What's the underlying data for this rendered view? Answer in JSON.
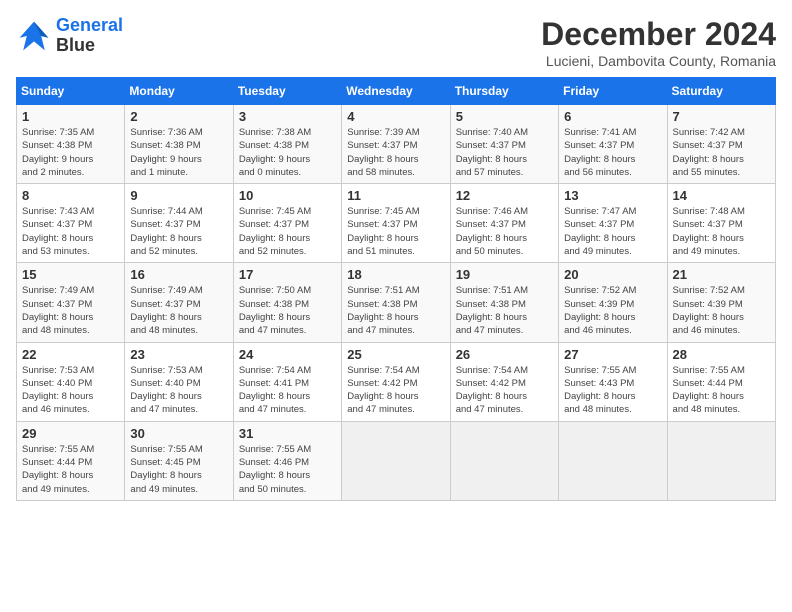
{
  "header": {
    "logo_line1": "General",
    "logo_line2": "Blue",
    "title": "December 2024",
    "subtitle": "Lucieni, Dambovita County, Romania"
  },
  "columns": [
    "Sunday",
    "Monday",
    "Tuesday",
    "Wednesday",
    "Thursday",
    "Friday",
    "Saturday"
  ],
  "weeks": [
    [
      {
        "day": "1",
        "info": "Sunrise: 7:35 AM\nSunset: 4:38 PM\nDaylight: 9 hours\nand 2 minutes."
      },
      {
        "day": "2",
        "info": "Sunrise: 7:36 AM\nSunset: 4:38 PM\nDaylight: 9 hours\nand 1 minute."
      },
      {
        "day": "3",
        "info": "Sunrise: 7:38 AM\nSunset: 4:38 PM\nDaylight: 9 hours\nand 0 minutes."
      },
      {
        "day": "4",
        "info": "Sunrise: 7:39 AM\nSunset: 4:37 PM\nDaylight: 8 hours\nand 58 minutes."
      },
      {
        "day": "5",
        "info": "Sunrise: 7:40 AM\nSunset: 4:37 PM\nDaylight: 8 hours\nand 57 minutes."
      },
      {
        "day": "6",
        "info": "Sunrise: 7:41 AM\nSunset: 4:37 PM\nDaylight: 8 hours\nand 56 minutes."
      },
      {
        "day": "7",
        "info": "Sunrise: 7:42 AM\nSunset: 4:37 PM\nDaylight: 8 hours\nand 55 minutes."
      }
    ],
    [
      {
        "day": "8",
        "info": "Sunrise: 7:43 AM\nSunset: 4:37 PM\nDaylight: 8 hours\nand 53 minutes."
      },
      {
        "day": "9",
        "info": "Sunrise: 7:44 AM\nSunset: 4:37 PM\nDaylight: 8 hours\nand 52 minutes."
      },
      {
        "day": "10",
        "info": "Sunrise: 7:45 AM\nSunset: 4:37 PM\nDaylight: 8 hours\nand 52 minutes."
      },
      {
        "day": "11",
        "info": "Sunrise: 7:45 AM\nSunset: 4:37 PM\nDaylight: 8 hours\nand 51 minutes."
      },
      {
        "day": "12",
        "info": "Sunrise: 7:46 AM\nSunset: 4:37 PM\nDaylight: 8 hours\nand 50 minutes."
      },
      {
        "day": "13",
        "info": "Sunrise: 7:47 AM\nSunset: 4:37 PM\nDaylight: 8 hours\nand 49 minutes."
      },
      {
        "day": "14",
        "info": "Sunrise: 7:48 AM\nSunset: 4:37 PM\nDaylight: 8 hours\nand 49 minutes."
      }
    ],
    [
      {
        "day": "15",
        "info": "Sunrise: 7:49 AM\nSunset: 4:37 PM\nDaylight: 8 hours\nand 48 minutes."
      },
      {
        "day": "16",
        "info": "Sunrise: 7:49 AM\nSunset: 4:37 PM\nDaylight: 8 hours\nand 48 minutes."
      },
      {
        "day": "17",
        "info": "Sunrise: 7:50 AM\nSunset: 4:38 PM\nDaylight: 8 hours\nand 47 minutes."
      },
      {
        "day": "18",
        "info": "Sunrise: 7:51 AM\nSunset: 4:38 PM\nDaylight: 8 hours\nand 47 minutes."
      },
      {
        "day": "19",
        "info": "Sunrise: 7:51 AM\nSunset: 4:38 PM\nDaylight: 8 hours\nand 47 minutes."
      },
      {
        "day": "20",
        "info": "Sunrise: 7:52 AM\nSunset: 4:39 PM\nDaylight: 8 hours\nand 46 minutes."
      },
      {
        "day": "21",
        "info": "Sunrise: 7:52 AM\nSunset: 4:39 PM\nDaylight: 8 hours\nand 46 minutes."
      }
    ],
    [
      {
        "day": "22",
        "info": "Sunrise: 7:53 AM\nSunset: 4:40 PM\nDaylight: 8 hours\nand 46 minutes."
      },
      {
        "day": "23",
        "info": "Sunrise: 7:53 AM\nSunset: 4:40 PM\nDaylight: 8 hours\nand 47 minutes."
      },
      {
        "day": "24",
        "info": "Sunrise: 7:54 AM\nSunset: 4:41 PM\nDaylight: 8 hours\nand 47 minutes."
      },
      {
        "day": "25",
        "info": "Sunrise: 7:54 AM\nSunset: 4:42 PM\nDaylight: 8 hours\nand 47 minutes."
      },
      {
        "day": "26",
        "info": "Sunrise: 7:54 AM\nSunset: 4:42 PM\nDaylight: 8 hours\nand 47 minutes."
      },
      {
        "day": "27",
        "info": "Sunrise: 7:55 AM\nSunset: 4:43 PM\nDaylight: 8 hours\nand 48 minutes."
      },
      {
        "day": "28",
        "info": "Sunrise: 7:55 AM\nSunset: 4:44 PM\nDaylight: 8 hours\nand 48 minutes."
      }
    ],
    [
      {
        "day": "29",
        "info": "Sunrise: 7:55 AM\nSunset: 4:44 PM\nDaylight: 8 hours\nand 49 minutes."
      },
      {
        "day": "30",
        "info": "Sunrise: 7:55 AM\nSunset: 4:45 PM\nDaylight: 8 hours\nand 49 minutes."
      },
      {
        "day": "31",
        "info": "Sunrise: 7:55 AM\nSunset: 4:46 PM\nDaylight: 8 hours\nand 50 minutes."
      },
      {
        "day": "",
        "info": ""
      },
      {
        "day": "",
        "info": ""
      },
      {
        "day": "",
        "info": ""
      },
      {
        "day": "",
        "info": ""
      }
    ]
  ]
}
